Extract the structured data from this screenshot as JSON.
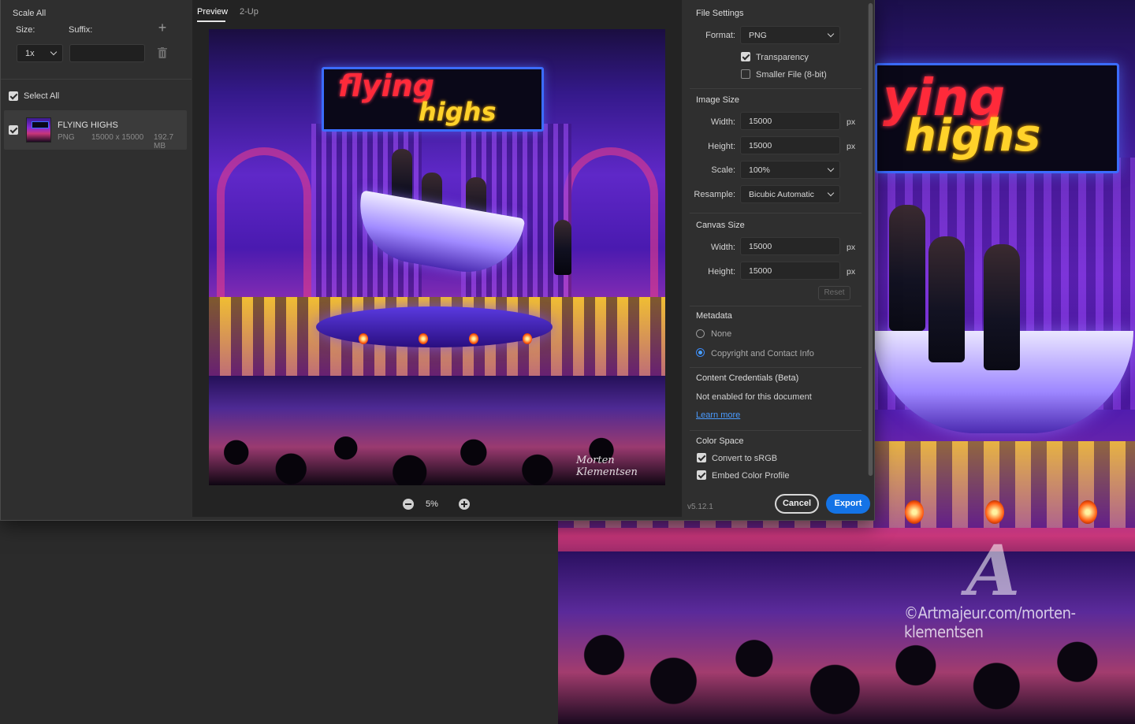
{
  "left": {
    "scale_all": "Scale All",
    "size_label": "Size:",
    "suffix_label": "Suffix:",
    "size_value": "1x",
    "suffix_value": "",
    "select_all": "Select All",
    "asset": {
      "name": "FLYING HIGHS",
      "format": "PNG",
      "dimensions": "15000 x 15000",
      "size": "192.7 MB"
    }
  },
  "center": {
    "tabs": [
      "Preview",
      "2-Up"
    ],
    "zoom": "5%",
    "artwork": {
      "sign_line1": "flying",
      "sign_line2": "highs",
      "signature": "Morten Klementsen"
    }
  },
  "right": {
    "file_settings": {
      "title": "File Settings",
      "format_label": "Format:",
      "format_value": "PNG",
      "transparency": "Transparency",
      "smaller_file": "Smaller File (8-bit)"
    },
    "image_size": {
      "title": "Image Size",
      "width_label": "Width:",
      "width_value": "15000",
      "height_label": "Height:",
      "height_value": "15000",
      "scale_label": "Scale:",
      "scale_value": "100%",
      "resample_label": "Resample:",
      "resample_value": "Bicubic Automatic",
      "unit": "px"
    },
    "canvas_size": {
      "title": "Canvas Size",
      "width_label": "Width:",
      "width_value": "15000",
      "height_label": "Height:",
      "height_value": "15000",
      "unit": "px",
      "reset": "Reset"
    },
    "metadata": {
      "title": "Metadata",
      "none": "None",
      "copyright": "Copyright and Contact Info"
    },
    "content_credentials": {
      "title": "Content Credentials (Beta)",
      "status": "Not enabled for this document",
      "learn_more": "Learn more"
    },
    "color_space": {
      "title": "Color Space",
      "convert": "Convert to sRGB",
      "embed": "Embed Color Profile"
    },
    "version": "v5.12.1",
    "cancel": "Cancel",
    "export": "Export"
  },
  "background": {
    "sign_line1": "ying",
    "sign_line2": "highs",
    "watermark_logo": "A",
    "watermark_text": "©Artmajeur.com/morten-klementsen"
  },
  "colors": {
    "accent": "#1473e6",
    "link": "#4a9bff",
    "panel": "#2f2f2f",
    "preview_bg": "#232323"
  }
}
